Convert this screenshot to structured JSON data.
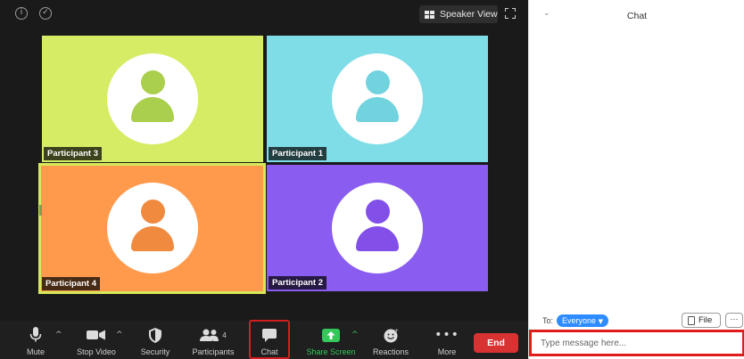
{
  "meeting": {
    "speaker_view_label": "Speaker View",
    "icons": [
      "info-icon",
      "shield-check-icon",
      "grid-icon",
      "fullscreen-icon"
    ],
    "participants": [
      {
        "name": "Participant 3",
        "bg": "#d6ec64",
        "fg": "#a9cf4c"
      },
      {
        "name": "Participant 1",
        "bg": "#7fdde8",
        "fg": "#70d3de"
      },
      {
        "name": "Participant 4",
        "bg": "#ff9a4d",
        "fg": "#f08a3e",
        "active": true
      },
      {
        "name": "Participant 2",
        "bg": "#8a5cf0",
        "fg": "#8250e8"
      }
    ]
  },
  "toolbar": {
    "mute": "Mute",
    "stop_video": "Stop Video",
    "security": "Security",
    "participants": "Participants",
    "participants_count": "4",
    "chat": "Chat",
    "share_screen": "Share Screen",
    "reactions": "Reactions",
    "more": "More",
    "end": "End",
    "colors": {
      "share": "#34c759",
      "end": "#d83232",
      "highlight": "#d11f1f"
    }
  },
  "chat": {
    "title": "Chat",
    "to_label": "To:",
    "recipient": "Everyone",
    "file_label": "File",
    "more_label": "···",
    "input_placeholder": "Type message here...",
    "colors": {
      "recipient": "#2d8cff",
      "input_border": "#e11b1b"
    }
  }
}
